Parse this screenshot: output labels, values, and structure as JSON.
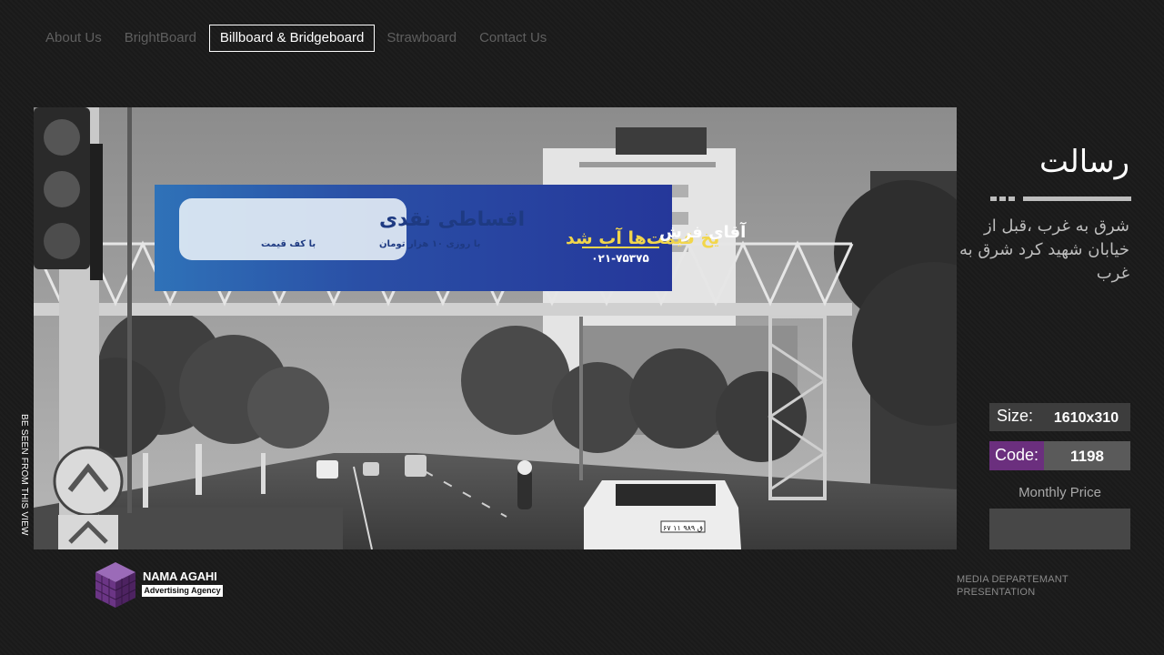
{
  "nav": {
    "items": [
      {
        "label": "About Us"
      },
      {
        "label": "BrightBoard"
      },
      {
        "label": "Billboard & Bridgeboard"
      },
      {
        "label": "Strawboard"
      },
      {
        "label": "Contact Us"
      }
    ]
  },
  "photo": {
    "ad_headline": "یخ قیمت‌ها آب شد",
    "ad_brand": "آقای فرش",
    "ad_phone": "۰۲۱-۷۵۳۷۵",
    "ad_block_title": "اقساطی نقدی",
    "ad_block_sub_right": "با روزی ۱۰ هزار تومان",
    "ad_block_sub_left": "با کف قیمت",
    "car_plate": "۶۷ ق ۹۸۹ ۱۱"
  },
  "caption": {
    "vertical": "BE SEEN FROM THIS VIEW"
  },
  "panel": {
    "title": "رسالت",
    "address": "شرق به غرب ،قبل از خیابان شهید کرد شرق به غرب",
    "size_label": "Size:",
    "size_value": "1610x310",
    "code_label": "Code:",
    "code_value": "1198",
    "price_label": "Monthly Price",
    "price_value": ""
  },
  "footer": {
    "brand_name": "NAMA AGAHI",
    "brand_tag": "Advertising Agency",
    "dept_line1": "MEDIA DEPARTEMANT",
    "dept_line2": "PRESENTATION"
  },
  "colors": {
    "accent": "#6b2f7e",
    "background": "#1a1a1a",
    "billboard": "#27409a",
    "billboard_text": "#f2d64b"
  },
  "icons": {
    "logo": "cube-icon"
  }
}
